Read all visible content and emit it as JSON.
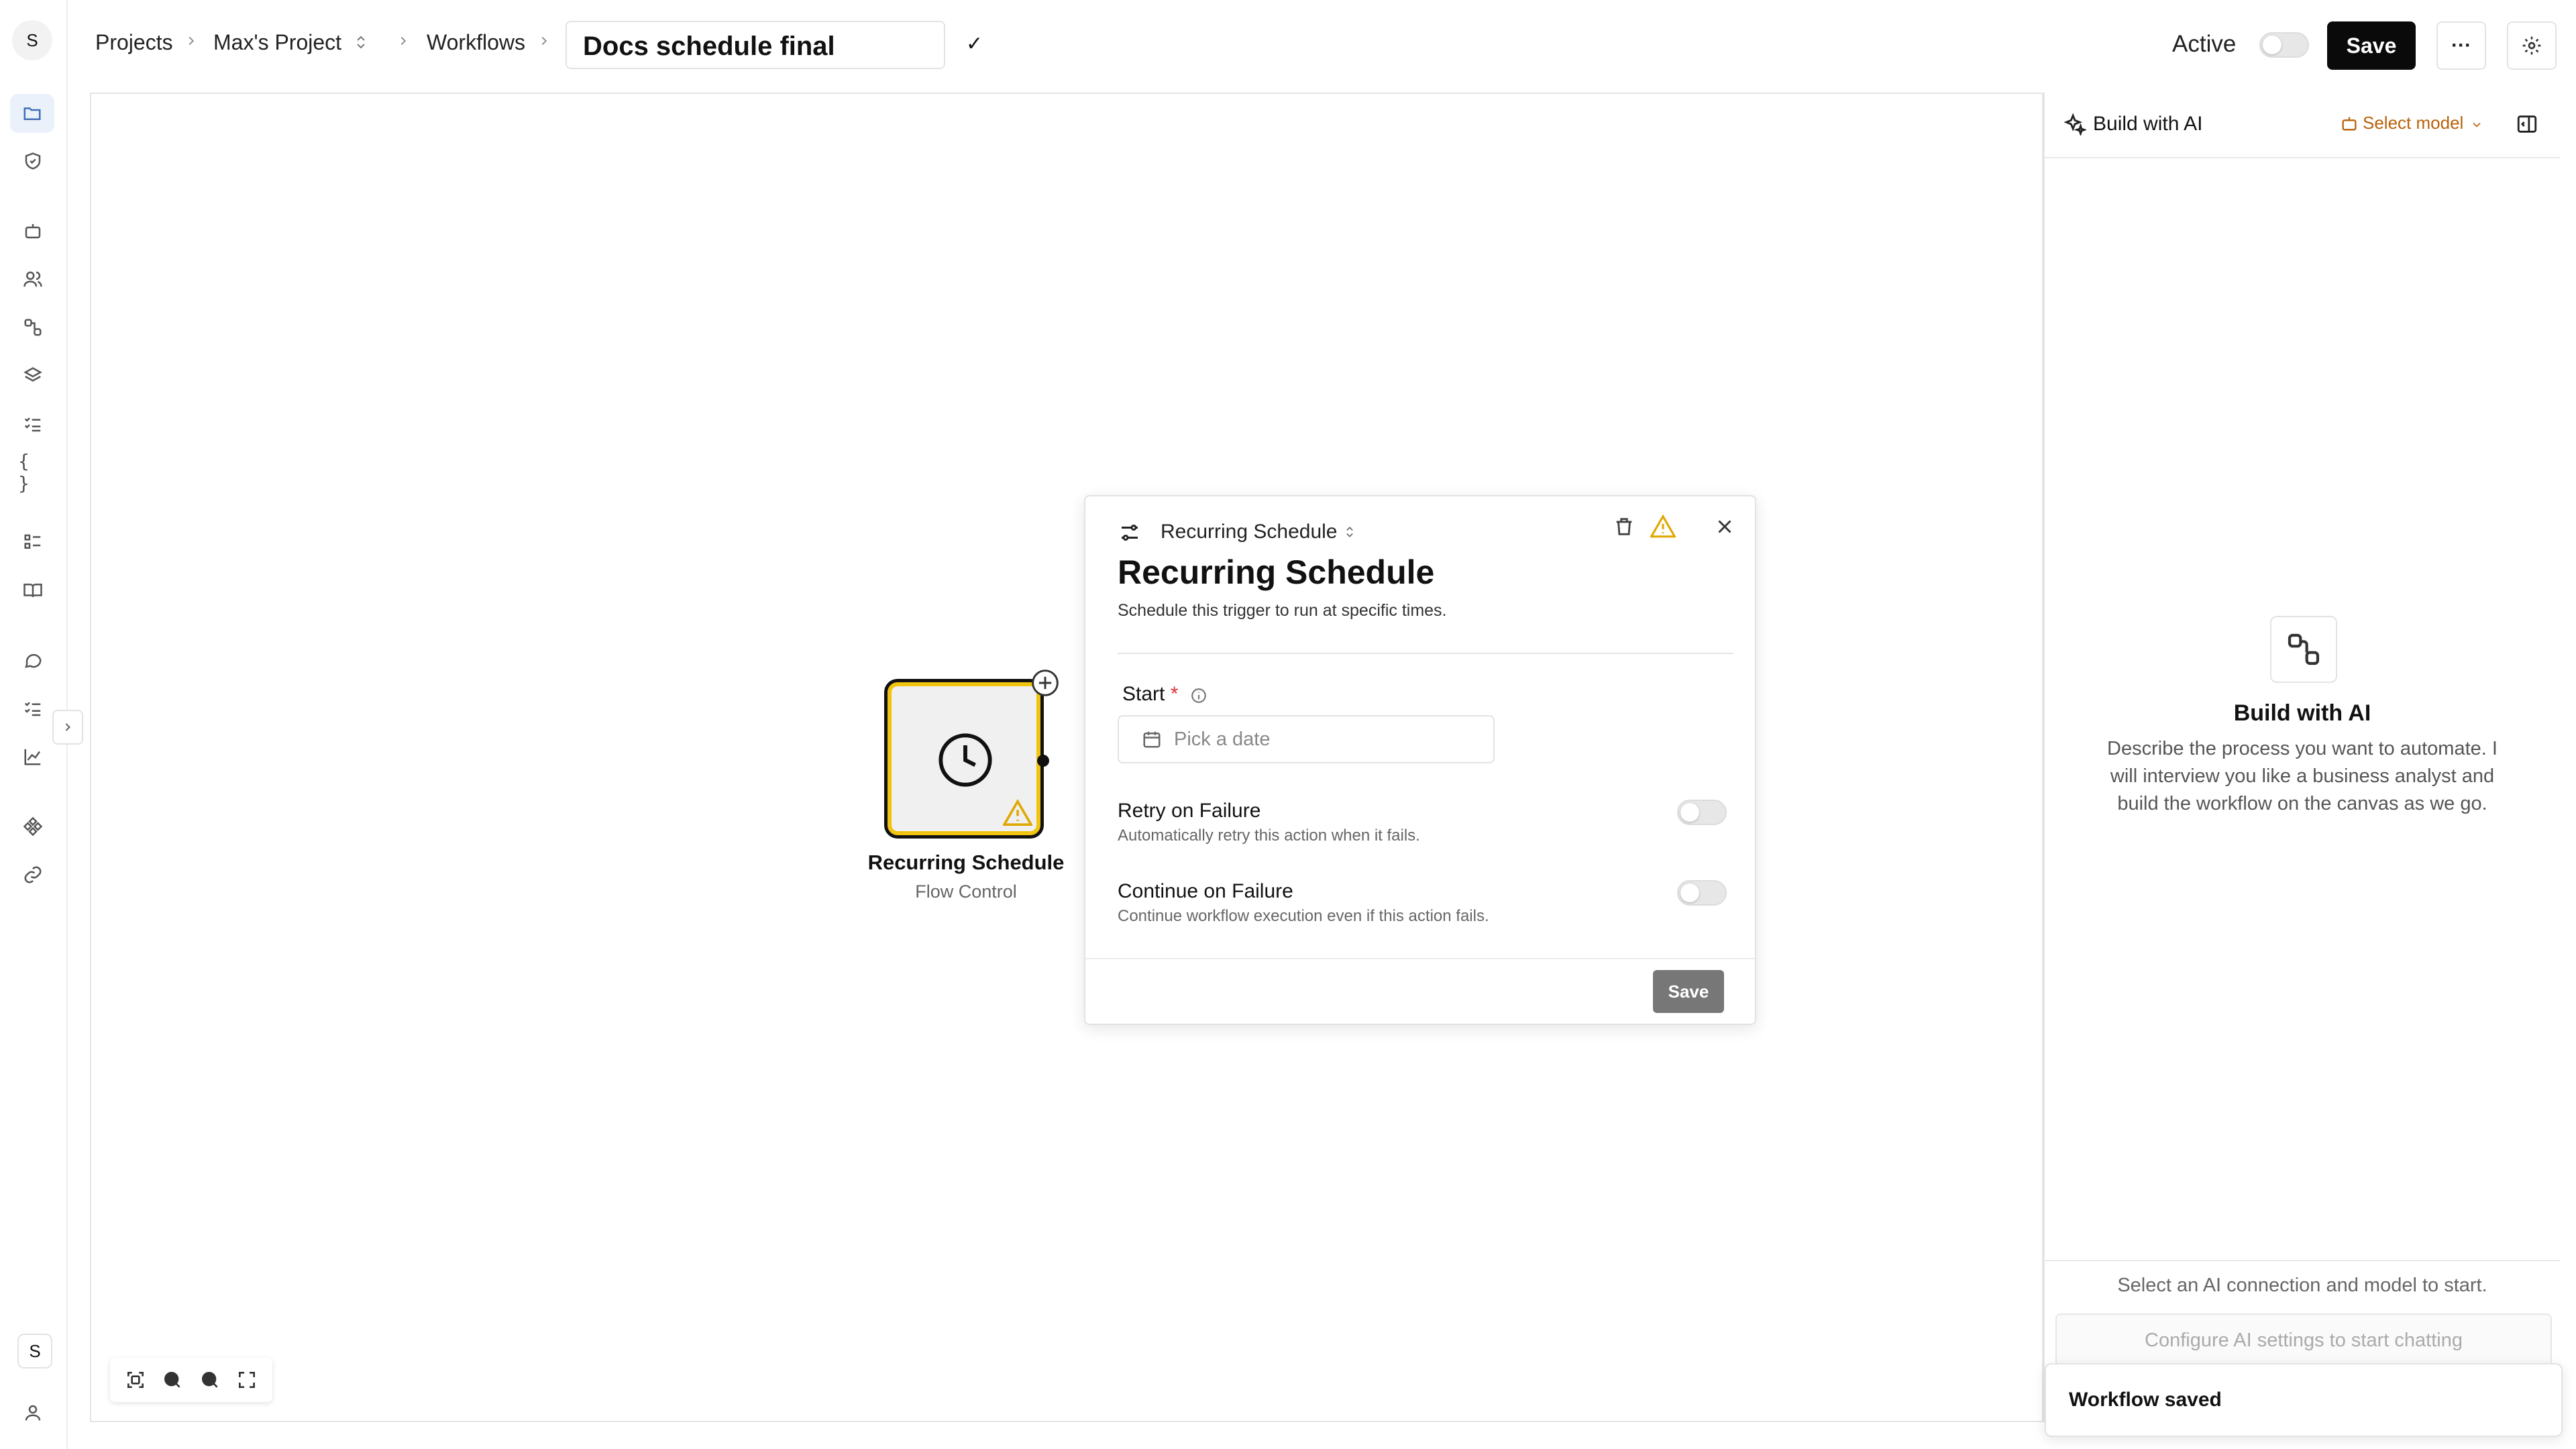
{
  "rail": {
    "avatar_letter": "S",
    "bottom_badge": "S",
    "icons": [
      "folder-icon",
      "shield-icon",
      "bot-icon",
      "users-icon",
      "nodes-icon",
      "layers-icon",
      "checklist-icon",
      "braces-icon",
      "list-icon",
      "book-icon",
      "chat-icon",
      "tasks-icon",
      "chart-icon",
      "puzzle-icon",
      "link-icon",
      "user-icon"
    ]
  },
  "header": {
    "breadcrumb": [
      "Projects",
      "Max's Project",
      "Workflows"
    ],
    "workflow_name": "Docs schedule final",
    "confirm_glyph": "✓",
    "active_label": "Active",
    "save_label": "Save",
    "more_glyph": "···"
  },
  "canvas": {
    "node": {
      "title": "Recurring Schedule",
      "subtitle": "Flow Control",
      "warning": true
    }
  },
  "panel": {
    "kind_label": "Recurring Schedule",
    "title": "Recurring Schedule",
    "description": "Schedule this trigger to run at specific times.",
    "start_label": "Start",
    "required_mark": "*",
    "date_placeholder": "Pick a date",
    "options": [
      {
        "title": "Retry on Failure",
        "desc": "Automatically retry this action when it fails.",
        "enabled": false
      },
      {
        "title": "Continue on Failure",
        "desc": "Continue workflow execution even if this action fails.",
        "enabled": false
      }
    ],
    "save_label": "Save"
  },
  "ai": {
    "title": "Build with AI",
    "model_label": "Select model",
    "heading": "Build with AI",
    "description": "Describe the process you want to automate. I will interview you like a business analyst and build the workflow on the canvas as we go.",
    "select_hint": "Select an AI connection and model to start.",
    "config_placeholder": "Configure AI settings to start chatting"
  },
  "toast": {
    "message": "Workflow saved"
  },
  "colors": {
    "accent_warning": "#f1c40f",
    "primary": "#0a0a0a",
    "model_label": "#b8620a"
  }
}
